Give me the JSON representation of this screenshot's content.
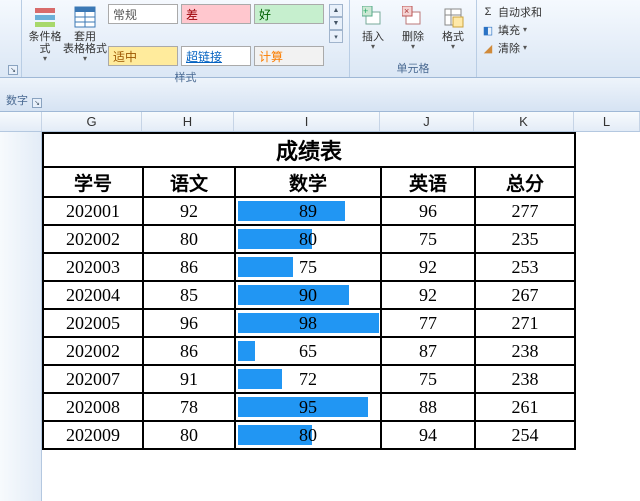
{
  "ribbon": {
    "group_styles_label": "样式",
    "group_cells_label": "单元格",
    "cond_fmt_label": "条件格式",
    "table_fmt_label": "套用\n表格格式",
    "insert_label": "插入",
    "delete_label": "删除",
    "format_label": "格式",
    "styles": {
      "general": "常规",
      "bad": "差",
      "good": "好",
      "shizhong": "适中",
      "link": "超链接",
      "calc": "计算"
    },
    "edit": {
      "autosum": "自动求和",
      "fill": "填充",
      "clear": "清除"
    }
  },
  "subbar_label": "数字",
  "cols": {
    "G": "G",
    "H": "H",
    "I": "I",
    "J": "J",
    "K": "K",
    "L": "L"
  },
  "chart_data": {
    "type": "table",
    "title": "成绩表",
    "headers": [
      "学号",
      "语文",
      "数学",
      "英语",
      "总分"
    ],
    "rows": [
      {
        "id": "202001",
        "yuwen": 92,
        "shuxue": 89,
        "yingyu": 96,
        "zongfen": 277
      },
      {
        "id": "202002",
        "yuwen": 80,
        "shuxue": 80,
        "yingyu": 75,
        "zongfen": 235
      },
      {
        "id": "202003",
        "yuwen": 86,
        "shuxue": 75,
        "yingyu": 92,
        "zongfen": 253
      },
      {
        "id": "202004",
        "yuwen": 85,
        "shuxue": 90,
        "yingyu": 92,
        "zongfen": 267
      },
      {
        "id": "202005",
        "yuwen": 96,
        "shuxue": 98,
        "yingyu": 77,
        "zongfen": 271
      },
      {
        "id": "202002",
        "yuwen": 86,
        "shuxue": 65,
        "yingyu": 87,
        "zongfen": 238
      },
      {
        "id": "202007",
        "yuwen": 91,
        "shuxue": 72,
        "yingyu": 75,
        "zongfen": 238
      },
      {
        "id": "202008",
        "yuwen": 78,
        "shuxue": 95,
        "yingyu": 88,
        "zongfen": 261
      },
      {
        "id": "202009",
        "yuwen": 80,
        "shuxue": 80,
        "yingyu": 94,
        "zongfen": 254
      }
    ],
    "databar_column": "shuxue",
    "databar_min": 65,
    "databar_max": 98
  }
}
